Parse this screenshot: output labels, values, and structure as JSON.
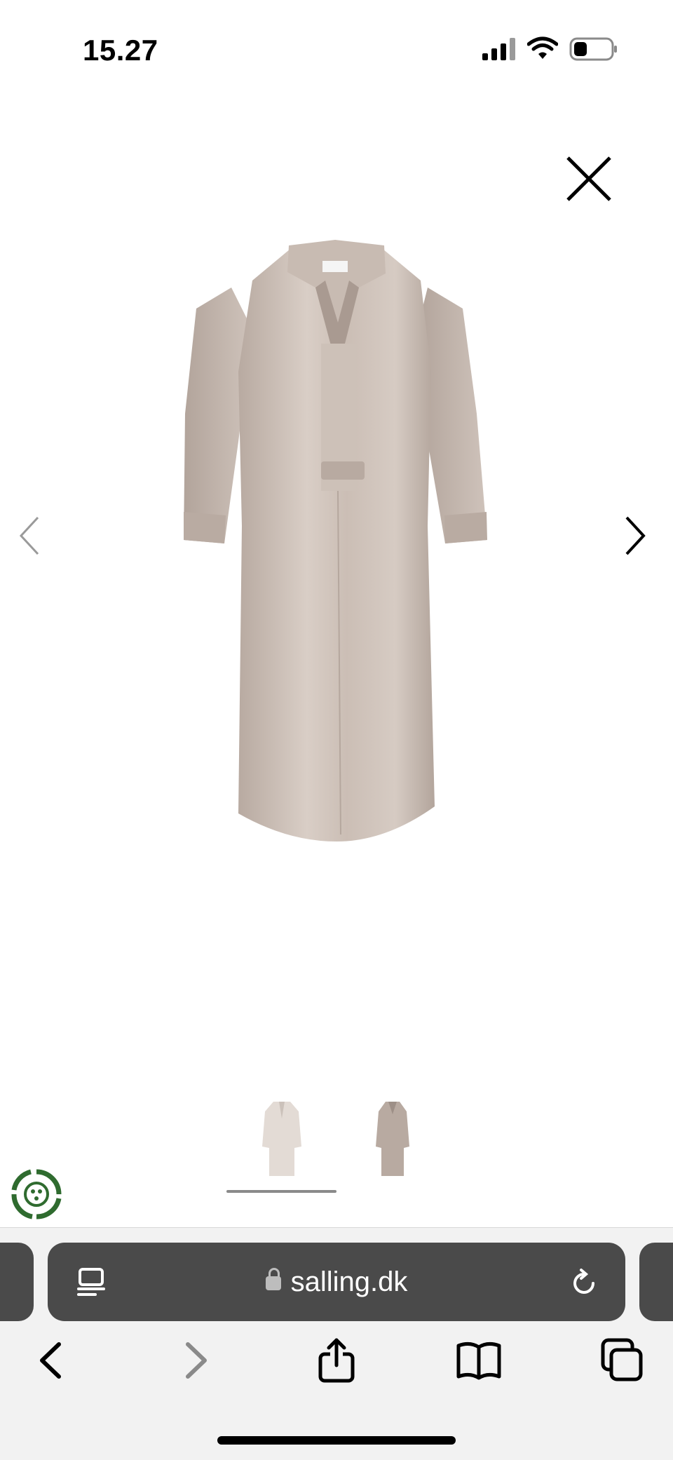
{
  "status_bar": {
    "time": "15.27",
    "icons": [
      "signal-icon",
      "wifi-icon",
      "battery-icon"
    ]
  },
  "gallery": {
    "close_icon": "close-icon",
    "prev_icon": "chevron-left-icon",
    "next_icon": "chevron-right-icon",
    "image_count": 2,
    "selected_index": 0,
    "product_color": "#cdbfb5"
  },
  "browser": {
    "url": "salling.dk",
    "page_menu_icon": "page-menu-icon",
    "reload_icon": "reload-icon",
    "nav": [
      "back-icon",
      "forward-icon",
      "share-icon",
      "bookmarks-icon",
      "tabs-icon"
    ]
  },
  "colors": {
    "address_bar": "#4a4a4a",
    "toolbar_bg": "#f2f2f2",
    "eco_green": "#2f6b2f"
  }
}
